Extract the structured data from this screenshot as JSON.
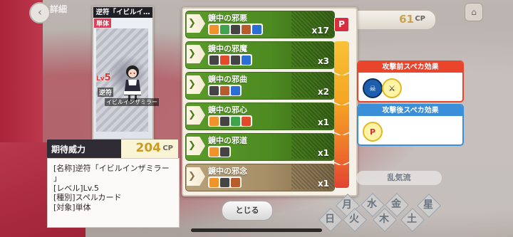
{
  "header": {
    "back_icon": "chevron-left-icon",
    "detail_tab": "詳細",
    "cp_value": "61",
    "cp_unit": "CP",
    "home_icon": "home-icon"
  },
  "card": {
    "title": "逆符「イビルイ…",
    "type": "単体",
    "level_prefix": "Lv",
    "level_value": "5",
    "subtitle1": "逆符",
    "subtitle2": "イビルインザミラー"
  },
  "power": {
    "label": "期待威力",
    "value": "204",
    "unit": "CP"
  },
  "info": [
    "[名称]逆符「イビルインザミラー",
    "」",
    "[レベル]Lv.5",
    "[種別]スペルカード",
    "[対象]単体"
  ],
  "shots": [
    {
      "name": "鏡中の邪悪",
      "count": "x17",
      "style": "green",
      "tags": [
        [
          "#f0932b",
          "person-icon"
        ],
        [
          "#3fa34d",
          "bolt-icon"
        ],
        [
          "#444",
          "slash-icon"
        ],
        [
          "#b85c2b",
          "orb-icon"
        ],
        [
          "#2b6fd6",
          "wave-icon"
        ]
      ]
    },
    {
      "name": "鏡中の邪魔",
      "count": "x3",
      "style": "green",
      "tags": [
        [
          "#444",
          "slash-icon"
        ],
        [
          "#e24a2a",
          "burst-icon"
        ],
        [
          "#444",
          "slash-icon"
        ],
        [
          "#2b6fd6",
          "wave-icon"
        ]
      ]
    },
    {
      "name": "鏡中の邪曲",
      "count": "x2",
      "style": "green",
      "tags": [
        [
          "#444",
          "slash-icon"
        ],
        [
          "#b85c2b",
          "orb-icon"
        ],
        [
          "#2b6fd6",
          "wave-icon"
        ]
      ]
    },
    {
      "name": "鏡中の邪心",
      "count": "x1",
      "style": "green",
      "tags": [
        [
          "#f0932b",
          "person-icon"
        ],
        [
          "#444",
          "slash-icon"
        ],
        [
          "#3fa34d",
          "clover-icon"
        ],
        [
          "#e24a2a",
          "flame-icon"
        ]
      ]
    },
    {
      "name": "鏡中の邪道",
      "count": "x1",
      "style": "green",
      "tags": [
        [
          "#f0932b",
          "person-icon"
        ],
        [
          "#444",
          "slash-icon"
        ]
      ]
    },
    {
      "name": "鏡中の邪念",
      "count": "x1",
      "style": "tan",
      "tags": [
        [
          "#f0932b",
          "person-icon"
        ],
        [
          "#444",
          "slash-icon"
        ],
        [
          "#b85c2b",
          "orb-icon"
        ]
      ]
    }
  ],
  "gauge_icon": "P",
  "close_button": "とじる",
  "effects": {
    "before": {
      "title": "攻撃前スペカ効果",
      "color": "#e8452c"
    },
    "after": {
      "title": "攻撃後スペカ効果",
      "color": "#3a8fd8"
    }
  },
  "weather_label": "乱気流",
  "elements": [
    "月",
    "水",
    "金",
    "星",
    "日",
    "火",
    "木",
    "土"
  ]
}
